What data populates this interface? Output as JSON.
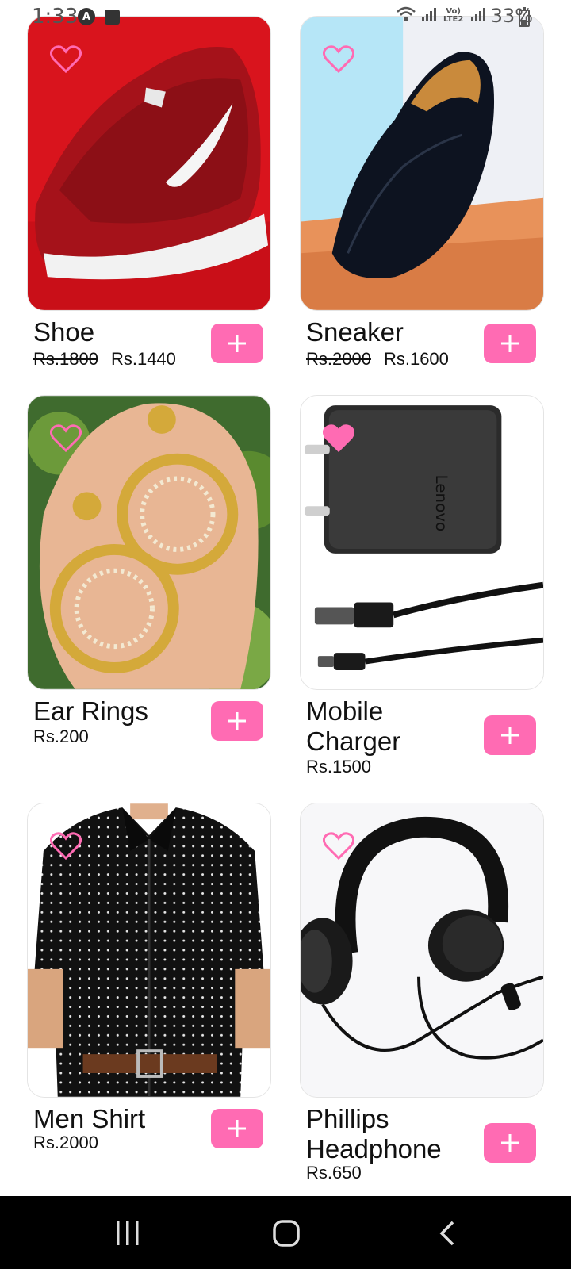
{
  "status_bar": {
    "time": "1:33",
    "badge_a": "A",
    "network_label": "Vo) LTE2",
    "battery": "33%"
  },
  "products": [
    {
      "name": "Shoe",
      "old_price": "Rs.1800",
      "price": "Rs.1440",
      "favorited": false,
      "image_icon": "red-sneaker-image"
    },
    {
      "name": "Sneaker",
      "old_price": "Rs.2000",
      "price": "Rs.1600",
      "favorited": false,
      "image_icon": "black-loafer-image"
    },
    {
      "name": "Ear Rings",
      "old_price": "",
      "price": "Rs.200",
      "favorited": false,
      "image_icon": "gold-earrings-image"
    },
    {
      "name": "Mobile Charger",
      "old_price": "",
      "price": "Rs.1500",
      "favorited": true,
      "image_icon": "charger-image",
      "brand_text": "Lenovo"
    },
    {
      "name": "Men Shirt",
      "old_price": "",
      "price": "Rs.2000",
      "favorited": false,
      "image_icon": "polka-dot-shirt-image"
    },
    {
      "name": "Phillips Headphone",
      "old_price": "",
      "price": "Rs.650",
      "favorited": false,
      "image_icon": "headphone-image"
    }
  ],
  "colors": {
    "accent": "#ff6bb3",
    "heart": "#ff6bb3",
    "nav_bar": "#000000"
  },
  "nav_bar": {
    "items": [
      "recent-apps-icon",
      "home-icon",
      "back-icon"
    ]
  }
}
